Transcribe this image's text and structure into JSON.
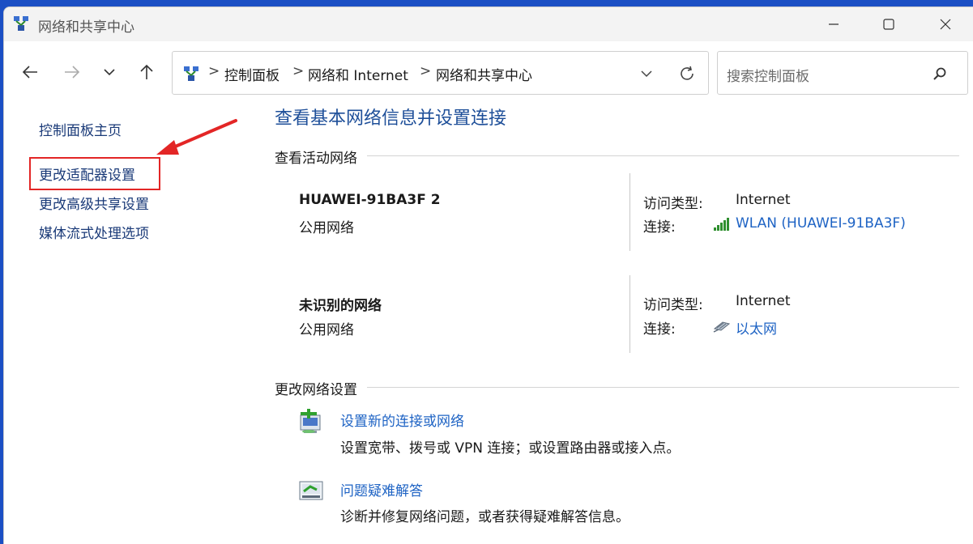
{
  "window": {
    "title": "网络和共享中心"
  },
  "address_bar": {
    "crumbs": [
      "控制面板",
      "网络和 Internet",
      "网络和共享中心"
    ],
    "separator": ">"
  },
  "search": {
    "placeholder": "搜索控制面板"
  },
  "sidebar": {
    "items": [
      {
        "label": "控制面板主页"
      },
      {
        "label": "更改适配器设置"
      },
      {
        "label": "更改高级共享设置"
      },
      {
        "label": "媒体流式处理选项"
      }
    ]
  },
  "main": {
    "title": "查看基本网络信息并设置连接",
    "active_networks_header": "查看活动网络",
    "networks": [
      {
        "name": "HUAWEI-91BA3F 2",
        "type": "公用网络",
        "access_label": "访问类型:",
        "access_value": "Internet",
        "connection_label": "连接:",
        "connection_value": "WLAN (HUAWEI-91BA3F)",
        "connection_icon": "wifi-signal-icon"
      },
      {
        "name": "未识别的网络",
        "type": "公用网络",
        "access_label": "访问类型:",
        "access_value": "Internet",
        "connection_label": "连接:",
        "connection_value": "以太网",
        "connection_icon": "ethernet-icon"
      }
    ],
    "change_settings_header": "更改网络设置",
    "tasks": [
      {
        "link": "设置新的连接或网络",
        "desc": "设置宽带、拨号或 VPN 连接；或设置路由器或接入点。",
        "icon": "new-connection-icon"
      },
      {
        "link": "问题疑难解答",
        "desc": "诊断并修复网络问题，或者获得疑难解答信息。",
        "icon": "troubleshoot-icon"
      }
    ]
  },
  "colors": {
    "link": "#1e63c4",
    "title": "#1e4f99",
    "highlight": "#e32626",
    "desktop": "#1b4fc4"
  }
}
